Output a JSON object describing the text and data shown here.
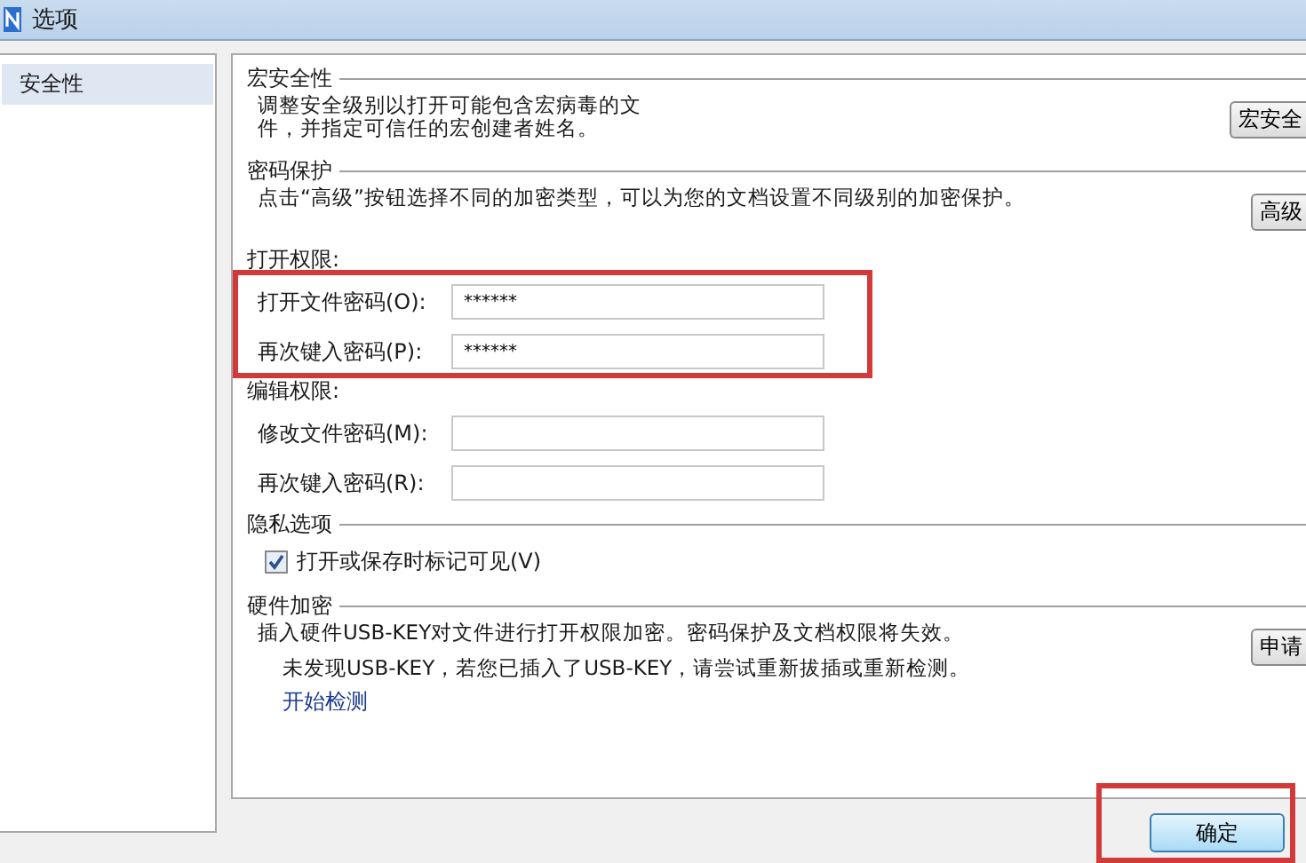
{
  "window": {
    "title": "选项"
  },
  "sidebar": {
    "items": [
      {
        "label": "安全性",
        "selected": true
      }
    ]
  },
  "macro_security": {
    "heading": "宏安全性",
    "description": "调整安全级别以打开可能包含宏病毒的文件，并指定可信任的宏创建者姓名。",
    "button": "宏安全"
  },
  "password_protection": {
    "heading": "密码保护",
    "description": "点击“高级”按钮选择不同的加密类型，可以为您的文档设置不同级别的加密保护。",
    "button": "高级",
    "groups": [
      {
        "title": "打开权限:",
        "highlighted": true,
        "fields": [
          {
            "label": "打开文件密码(O):",
            "value": "******"
          },
          {
            "label": "再次键入密码(P):",
            "value": "******"
          }
        ]
      },
      {
        "title": "编辑权限:",
        "highlighted": false,
        "fields": [
          {
            "label": "修改文件密码(M):"
          },
          {
            "label": "再次键入密码(R):"
          }
        ]
      }
    ]
  },
  "privacy": {
    "heading": "隐私选项",
    "checkbox": {
      "label": "打开或保存时标记可见(V)",
      "checked": true
    }
  },
  "hardware_encryption": {
    "heading": "硬件加密",
    "description": "插入硬件USB-KEY对文件进行打开权限加密。密码保护及文档权限将失效。",
    "button": "申请",
    "status": "未发现USB-KEY，若您已插入了USB-KEY，请尝试重新拔插或重新检测。",
    "link": "开始检测"
  },
  "footer": {
    "ok_button": "确定",
    "highlighted": true
  }
}
